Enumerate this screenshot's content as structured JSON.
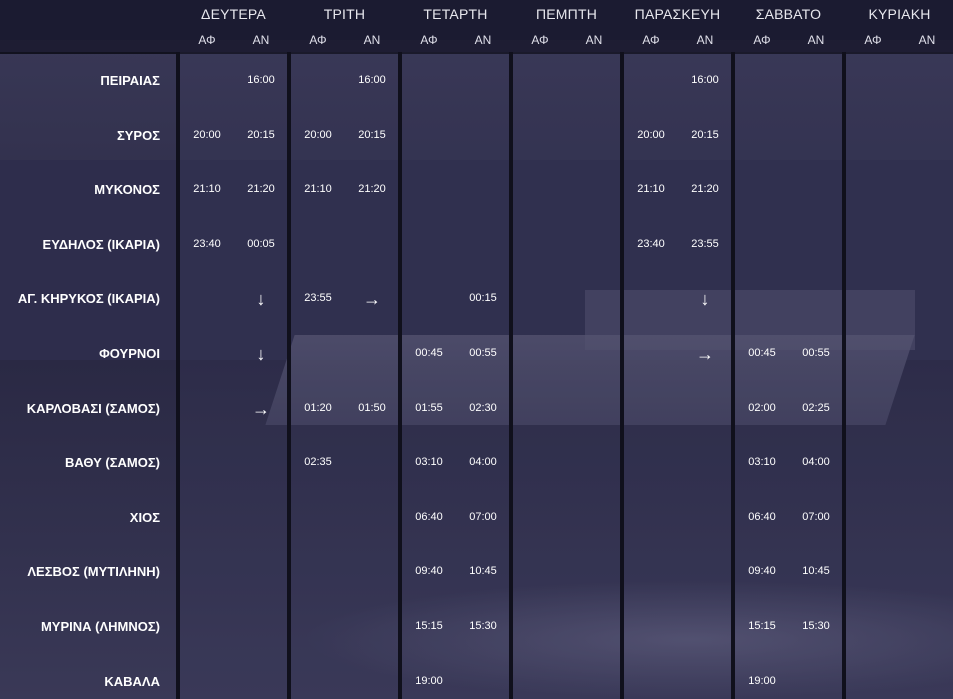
{
  "days": [
    {
      "label": "ΔΕΥΤΕΡΑ"
    },
    {
      "label": "ΤΡΙΤΗ"
    },
    {
      "label": "ΤΕΤΑΡΤΗ"
    },
    {
      "label": "ΠΕΜΠΤΗ"
    },
    {
      "label": "ΠΑΡΑΣΚΕΥΗ"
    },
    {
      "label": "ΣΑΒΒΑΤΟ"
    },
    {
      "label": "ΚΥΡΙΑΚΗ"
    }
  ],
  "sub": {
    "arrival": "ΑΦ",
    "departure": "ΑΝ"
  },
  "ports": [
    {
      "name": "ΠΕΙΡΑΙΑΣ",
      "times": [
        "",
        "16:00",
        "",
        "16:00",
        "",
        "",
        "",
        "",
        "",
        "16:00",
        "",
        "",
        "",
        ""
      ]
    },
    {
      "name": "ΣΥΡΟΣ",
      "times": [
        "20:00",
        "20:15",
        "20:00",
        "20:15",
        "",
        "",
        "",
        "",
        "20:00",
        "20:15",
        "",
        "",
        "",
        ""
      ]
    },
    {
      "name": "ΜΥΚΟΝΟΣ",
      "times": [
        "21:10",
        "21:20",
        "21:10",
        "21:20",
        "",
        "",
        "",
        "",
        "21:10",
        "21:20",
        "",
        "",
        "",
        ""
      ]
    },
    {
      "name": "ΕΥΔΗΛΟΣ (ΙΚΑΡΙΑ)",
      "times": [
        "23:40",
        "00:05",
        "",
        "",
        "",
        "",
        "",
        "",
        "23:40",
        "23:55",
        "",
        "",
        "",
        ""
      ]
    },
    {
      "name": "ΑΓ. ΚΗΡΥΚΟΣ (ΙΚΑΡΙΑ)",
      "times": [
        "",
        "↓",
        "23:55",
        "→",
        "",
        "00:15",
        "",
        "",
        "",
        "↓",
        "",
        "",
        "",
        ""
      ]
    },
    {
      "name": "ΦΟΥΡΝΟΙ",
      "times": [
        "",
        "↓",
        "",
        "",
        "00:45",
        "00:55",
        "",
        "",
        "",
        "→",
        "00:45",
        "00:55",
        "",
        ""
      ]
    },
    {
      "name": "ΚΑΡΛΟΒΑΣΙ (ΣΑΜΟΣ)",
      "times": [
        "",
        "→",
        "01:20",
        "01:50",
        "01:55",
        "02:30",
        "",
        "",
        "",
        "",
        "02:00",
        "02:25",
        "",
        ""
      ]
    },
    {
      "name": "ΒΑΘΥ (ΣΑΜΟΣ)",
      "times": [
        "",
        "",
        "02:35",
        "",
        "03:10",
        "04:00",
        "",
        "",
        "",
        "",
        "03:10",
        "04:00",
        "",
        ""
      ]
    },
    {
      "name": "ΧΙΟΣ",
      "times": [
        "",
        "",
        "",
        "",
        "06:40",
        "07:00",
        "",
        "",
        "",
        "",
        "06:40",
        "07:00",
        "",
        ""
      ]
    },
    {
      "name": "ΛΕΣΒΟΣ (ΜΥΤΙΛΗΝΗ)",
      "times": [
        "",
        "",
        "",
        "",
        "09:40",
        "10:45",
        "",
        "",
        "",
        "",
        "09:40",
        "10:45",
        "",
        ""
      ]
    },
    {
      "name": "ΜΥΡΙΝΑ (ΛΗΜΝΟΣ)",
      "times": [
        "",
        "",
        "",
        "",
        "15:15",
        "15:30",
        "",
        "",
        "",
        "",
        "15:15",
        "15:30",
        "",
        ""
      ]
    },
    {
      "name": "ΚΑΒΑΛΑ",
      "times": [
        "",
        "",
        "",
        "",
        "19:00",
        "",
        "",
        "",
        "",
        "",
        "19:00",
        "",
        "",
        ""
      ]
    }
  ]
}
